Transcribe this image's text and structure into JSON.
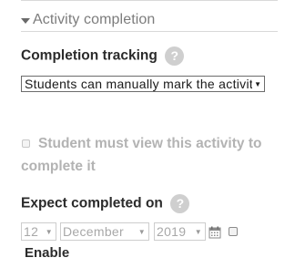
{
  "section": {
    "title": "Activity completion"
  },
  "completion_tracking": {
    "label": "Completion tracking",
    "help": "?",
    "selected": "Students can manually mark the activity as completed"
  },
  "view_requirement": {
    "label_line1": "Student must view this activity to",
    "label_line2": "complete it"
  },
  "expect_completed": {
    "label": "Expect completed on",
    "help": "?",
    "day": "12",
    "month": "December",
    "year": "2019",
    "enable_label": "Enable"
  }
}
